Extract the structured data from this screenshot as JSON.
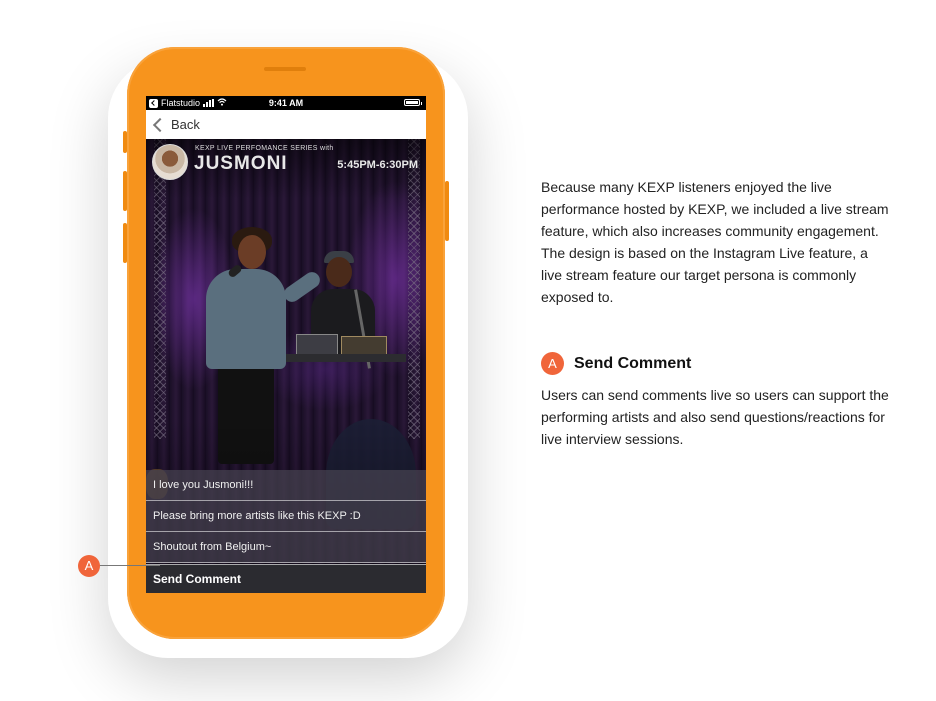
{
  "status_bar": {
    "carrier": "Flatstudio",
    "time": "9:41 AM"
  },
  "nav": {
    "back_label": "Back"
  },
  "live": {
    "series_label": "KEXP LIVE PERFOMANCE SERIES with",
    "artist_name": "JUSMONI",
    "show_time": "5:45PM-6:30PM"
  },
  "comments": [
    "I love you Jusmoni!!!",
    "Please bring more artists like this KEXP :D",
    "Shoutout from Belgium~"
  ],
  "send_comment_label": "Send Comment",
  "annotation": {
    "badge": "A"
  },
  "description": "Because many KEXP listeners enjoyed the live performance hosted by KEXP, we included a live stream feature, which also increases community engagement.  The design is based on the Instagram Live feature, a live stream feature our target persona is commonly exposed to.",
  "section": {
    "badge": "A",
    "title": "Send Comment",
    "body": "Users can send comments live so users can support the performing artists and also send questions/reactions for live interview sessions."
  },
  "colors": {
    "phone": "#f7941d",
    "accent": "#f0653a"
  }
}
